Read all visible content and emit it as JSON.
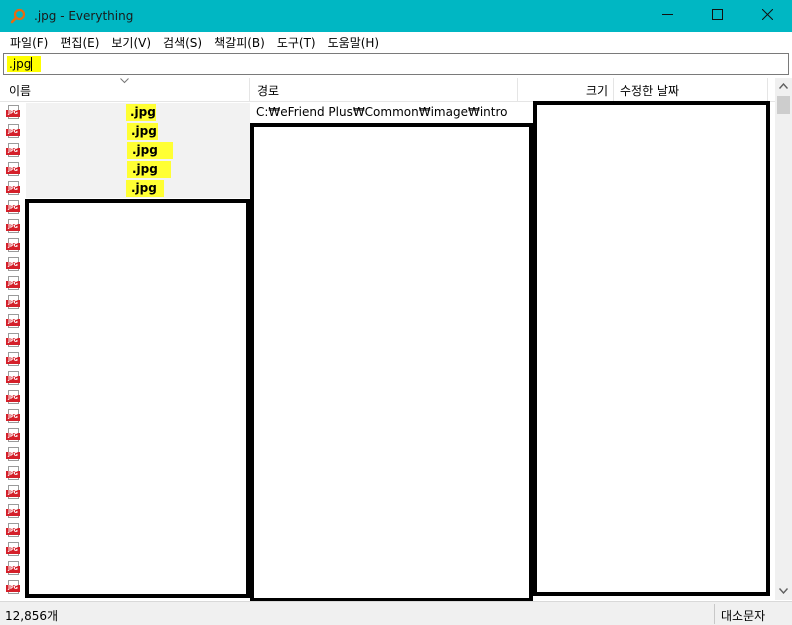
{
  "window": {
    "title": ".jpg - Everything",
    "minimize_glyph": "—",
    "maximize_glyph": "☐",
    "close_glyph": "✕"
  },
  "menu": [
    {
      "label": "파일(F)"
    },
    {
      "label": "편집(E)"
    },
    {
      "label": "보기(V)"
    },
    {
      "label": "검색(S)"
    },
    {
      "label": "책갈피(B)"
    },
    {
      "label": "도구(T)"
    },
    {
      "label": "도움말(H)"
    }
  ],
  "search": {
    "value": ".jpg"
  },
  "columns": {
    "name": "이름",
    "path": "경로",
    "size": "크기",
    "modified": "수정한 날짜"
  },
  "rows": [
    {
      "name_visible": ".jpg",
      "path": "C:₩eFriend Plus₩Common₩image₩intro"
    },
    {
      "name_visible": ".jpg",
      "path": ""
    },
    {
      "name_visible": ".jpg",
      "path": ""
    },
    {
      "name_visible": ".jpg",
      "path": ""
    },
    {
      "name_visible": ".jpg",
      "path": ""
    }
  ],
  "file_icon_label": "JPG",
  "icon_row_count": 26,
  "status": {
    "count": "12,856개",
    "case": "대소문자"
  },
  "colors": {
    "titlebar": "#00b7c3",
    "highlight": "#ffff33",
    "jpg_icon": "#d4202a"
  },
  "icons": {
    "app": "magnifier-icon",
    "file": "jpg-file-icon"
  }
}
